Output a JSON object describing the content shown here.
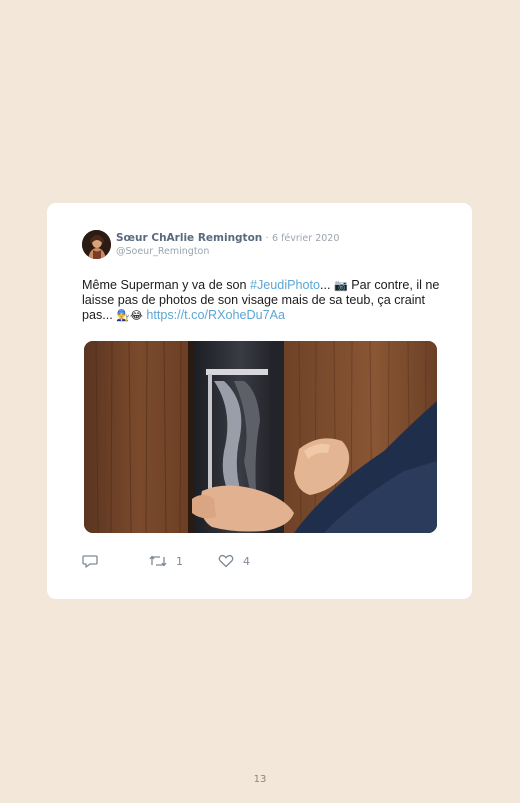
{
  "tweet": {
    "author_name": "Sœur ChArlie Remington",
    "separator": "·",
    "date": "6 février 2020",
    "handle": "@Soeur_Remington",
    "text_part1": "Même Superman y va de son ",
    "hashtag": "#JeudiPhoto",
    "text_part2": "... ",
    "camera_emoji": "📷",
    "text_part3": " Par contre, il ne laisse pas de photos de son visage mais de sa teub, ça craint pas... ",
    "emojis": "👨‍🔧😂",
    "link": "https://t.co/RXoheDu7Aa",
    "retweet_count": "1",
    "like_count": "4"
  },
  "icons": {
    "reply": "reply-icon",
    "retweet": "retweet-icon",
    "like": "heart-icon"
  },
  "colors": {
    "page_background": "#f3e7da",
    "card_background": "#ffffff",
    "link": "#5ba6d6",
    "author": "#586a7d",
    "muted": "#9aa4ae"
  },
  "page_number": "13"
}
